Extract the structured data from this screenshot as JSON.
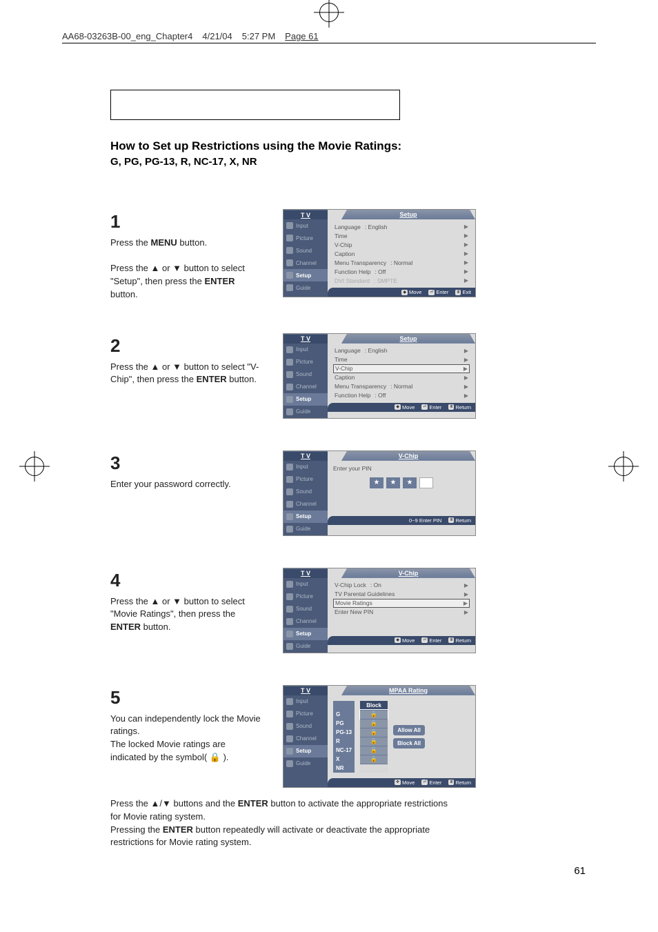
{
  "header": {
    "file": "AA68-03263B-00_eng_Chapter4",
    "date": "4/21/04",
    "time": "5:27 PM",
    "page": "Page 61"
  },
  "page_number": "61",
  "title": "How to Set up Restrictions using the Movie Ratings:",
  "subtitle": "G, PG, PG-13, R, NC-17, X, NR",
  "step1": {
    "num": "1",
    "line1_a": "Press the ",
    "line1_b": "MENU",
    "line1_c": " button.",
    "line2_a": "Press the ▲ or ▼ button to select \"Setup\", then press the ",
    "line2_b": "ENTER",
    "line2_c": " button."
  },
  "step2": {
    "num": "2",
    "line_a": "Press the ▲ or ▼ button to select \"V-Chip\", then press the ",
    "line_b": "ENTER",
    "line_c": " button."
  },
  "step3": {
    "num": "3",
    "text": "Enter your password correctly."
  },
  "step4": {
    "num": "4",
    "line_a": "Press the ▲ or ▼ button to select \"Movie Ratings\", then press the ",
    "line_b": "ENTER",
    "line_c": "     button."
  },
  "step5": {
    "num": "5",
    "text": "You can independently lock the Movie ratings.\nThe locked Movie ratings are indicated by the symbol( 🔒 )."
  },
  "bottom": {
    "p1_a": "Press the ▲/▼ buttons and the ",
    "p1_b": "ENTER",
    "p1_c": " button to activate the appropriate restrictions for Movie rating system.",
    "p2_a": "Pressing the ",
    "p2_b": "ENTER",
    "p2_c": " button repeatedly will activate or deactivate the appropriate restrictions for Movie rating system."
  },
  "osd": {
    "tv": "T V",
    "sidebar": [
      "Input",
      "Picture",
      "Sound",
      "Channel",
      "Setup",
      "Guide"
    ],
    "setup_title": "Setup",
    "vchip_title": "V-Chip",
    "mpaa_title": "MPAA Rating",
    "setup_rows": [
      {
        "label": "Language",
        "val": ":  English"
      },
      {
        "label": "Time",
        "val": ""
      },
      {
        "label": "V-Chip",
        "val": ""
      },
      {
        "label": "Caption",
        "val": ""
      },
      {
        "label": "Menu Transparency",
        "val": ":  Normal"
      },
      {
        "label": "Function Help",
        "val": ":  Off"
      },
      {
        "label": "DVI Standard",
        "val": ":  SMPTE"
      }
    ],
    "setup2_rows": [
      {
        "label": "Language",
        "val": ":  English"
      },
      {
        "label": "Time",
        "val": ""
      },
      {
        "label": "V-Chip",
        "val": ""
      },
      {
        "label": "Caption",
        "val": ""
      },
      {
        "label": "Menu Transparency",
        "val": ":  Normal"
      },
      {
        "label": "Function Help",
        "val": ":  Off"
      }
    ],
    "pin_label": "Enter your PIN",
    "pin_footer": "0~9 Enter PIN",
    "vchip_rows": [
      {
        "label": "V-Chip Lock",
        "val": ":  On"
      },
      {
        "label": "TV Parental Guidelines",
        "val": ""
      },
      {
        "label": "Movie Ratings",
        "val": ""
      },
      {
        "label": "Enter New PIN",
        "val": ""
      }
    ],
    "mpaa": {
      "block": "Block",
      "labels": [
        "G",
        "PG",
        "PG-13",
        "R",
        "NC-17",
        "X",
        "NR"
      ],
      "allow": "Allow All",
      "block_all": "Block All"
    },
    "foot_move": "Move",
    "foot_enter": "Enter",
    "foot_exit": "Exit",
    "foot_return": "Return"
  }
}
